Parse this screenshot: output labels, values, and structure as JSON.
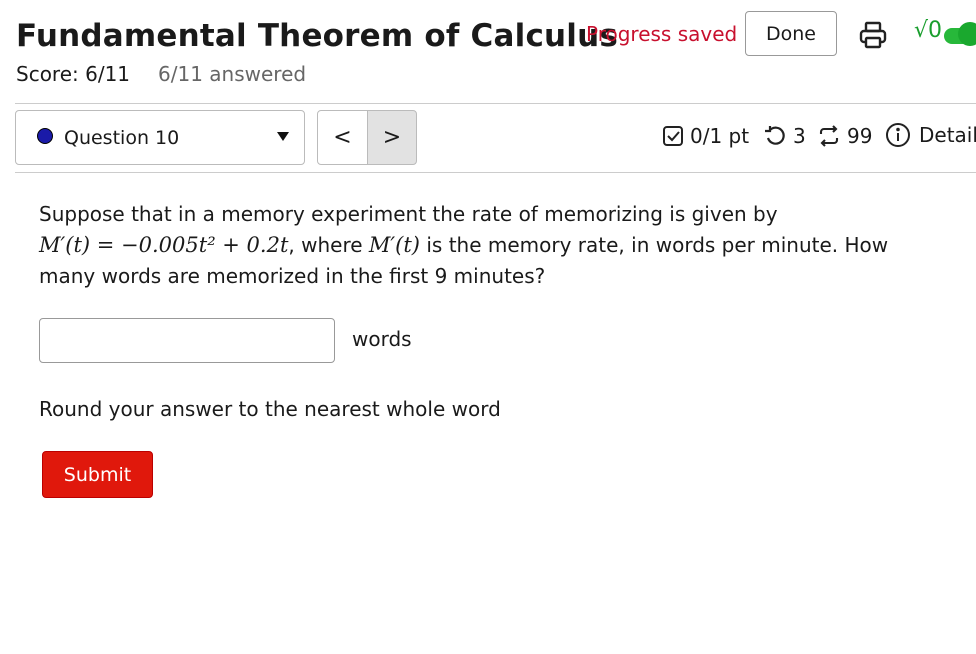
{
  "header": {
    "title": "Fundamental Theorem of Calculus",
    "score": "Score: 6/11",
    "answered": "6/11 answered",
    "progress_status": "Progress saved",
    "done_label": "Done",
    "sqrt_label": "√0"
  },
  "question_nav": {
    "selected": "Question 10",
    "prev_symbol": "<",
    "next_symbol": ">"
  },
  "question_meta": {
    "points": "0/1 pt",
    "retries": "3",
    "attempts": "99",
    "details_label": "Details"
  },
  "question": {
    "line1": "Suppose that in a memory experiment the rate of memorizing is given by",
    "equation": "M′(t) = −0.005t² + 0.2t",
    "where_text": ", where ",
    "rate_symbol": "M′(t)",
    "line2_rest": " is the memory rate, in words per minute. How",
    "line3": "many words are memorized in the first 9 minutes?",
    "answer_value": "",
    "units": "words",
    "instruction": "Round your answer to the nearest whole word",
    "submit_label": "Submit"
  },
  "colors": {
    "accent_red": "#e0180c",
    "saved_red": "#c8102e",
    "toggle_green": "#27b83a",
    "question_dot": "#1a1aa8"
  }
}
